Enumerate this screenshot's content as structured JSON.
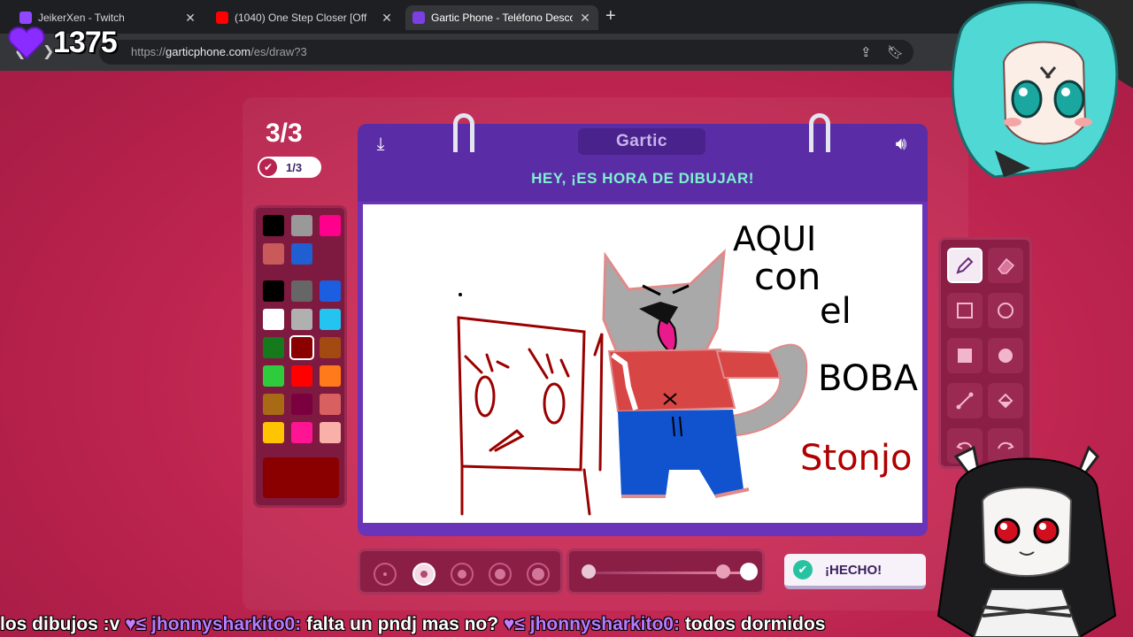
{
  "browser": {
    "tabs": [
      {
        "title": "JeikerXen - Twitch",
        "icon_color": "#9146ff",
        "active": false
      },
      {
        "title": "(1040) One Step Closer [Off",
        "icon_color": "#ff0000",
        "active": false
      },
      {
        "title": "Gartic Phone - Teléfono Descon",
        "icon_color": "#7b3fe4",
        "active": true
      }
    ],
    "new_tab_label": "+",
    "url_prefix": "https://",
    "url_host": "garticphone.com",
    "url_path": "/es/draw?3"
  },
  "stream": {
    "sub_count": "1375",
    "chat_ticker": [
      {
        "text": "los dibujos :v "
      },
      {
        "user": "jhonnysharkito0:",
        "text": " falta un pndj mas no? "
      },
      {
        "user": "jhonnysharkito0:",
        "text": " todos dormidos"
      }
    ]
  },
  "game": {
    "round": "3/3",
    "round_pill": "1/3",
    "logo": "Gartic",
    "title": "HEY, ¡ES HORA DE DIBUJAR!",
    "done_button": "¡HECHO!",
    "palette": [
      "#000000",
      "#999999",
      "#ff008c",
      "#c85a5a",
      "#1f5fd1",
      "#000000",
      "#666666",
      "#1b5fe0",
      "#ffffff",
      "#b0b0b0",
      "#24c4f0",
      "#157a1c",
      "#8a0000",
      "#a34a12",
      "#2ecc3c",
      "#ff0000",
      "#ff7a1a",
      "#a86a14",
      "#7a0040",
      "#d86060",
      "#ffc400",
      "#ff1493",
      "#f8b0a8"
    ],
    "selected_color": "#8a0000",
    "tools": [
      "pencil-icon",
      "eraser-icon",
      "rect-outline-icon",
      "circle-outline-icon",
      "rect-fill-icon",
      "circle-fill-icon",
      "line-icon",
      "fill-bucket-icon",
      "undo-icon",
      "redo-icon"
    ],
    "brush_sizes": [
      "xs",
      "s",
      "m",
      "l",
      "xl"
    ],
    "selected_brush": 1,
    "drawing_text": [
      "AQUI",
      "con",
      "el",
      "BOBA",
      "Stonjo"
    ]
  },
  "colors": {
    "accent_purple": "#5a2da6",
    "title_green": "#7ef0d0"
  }
}
